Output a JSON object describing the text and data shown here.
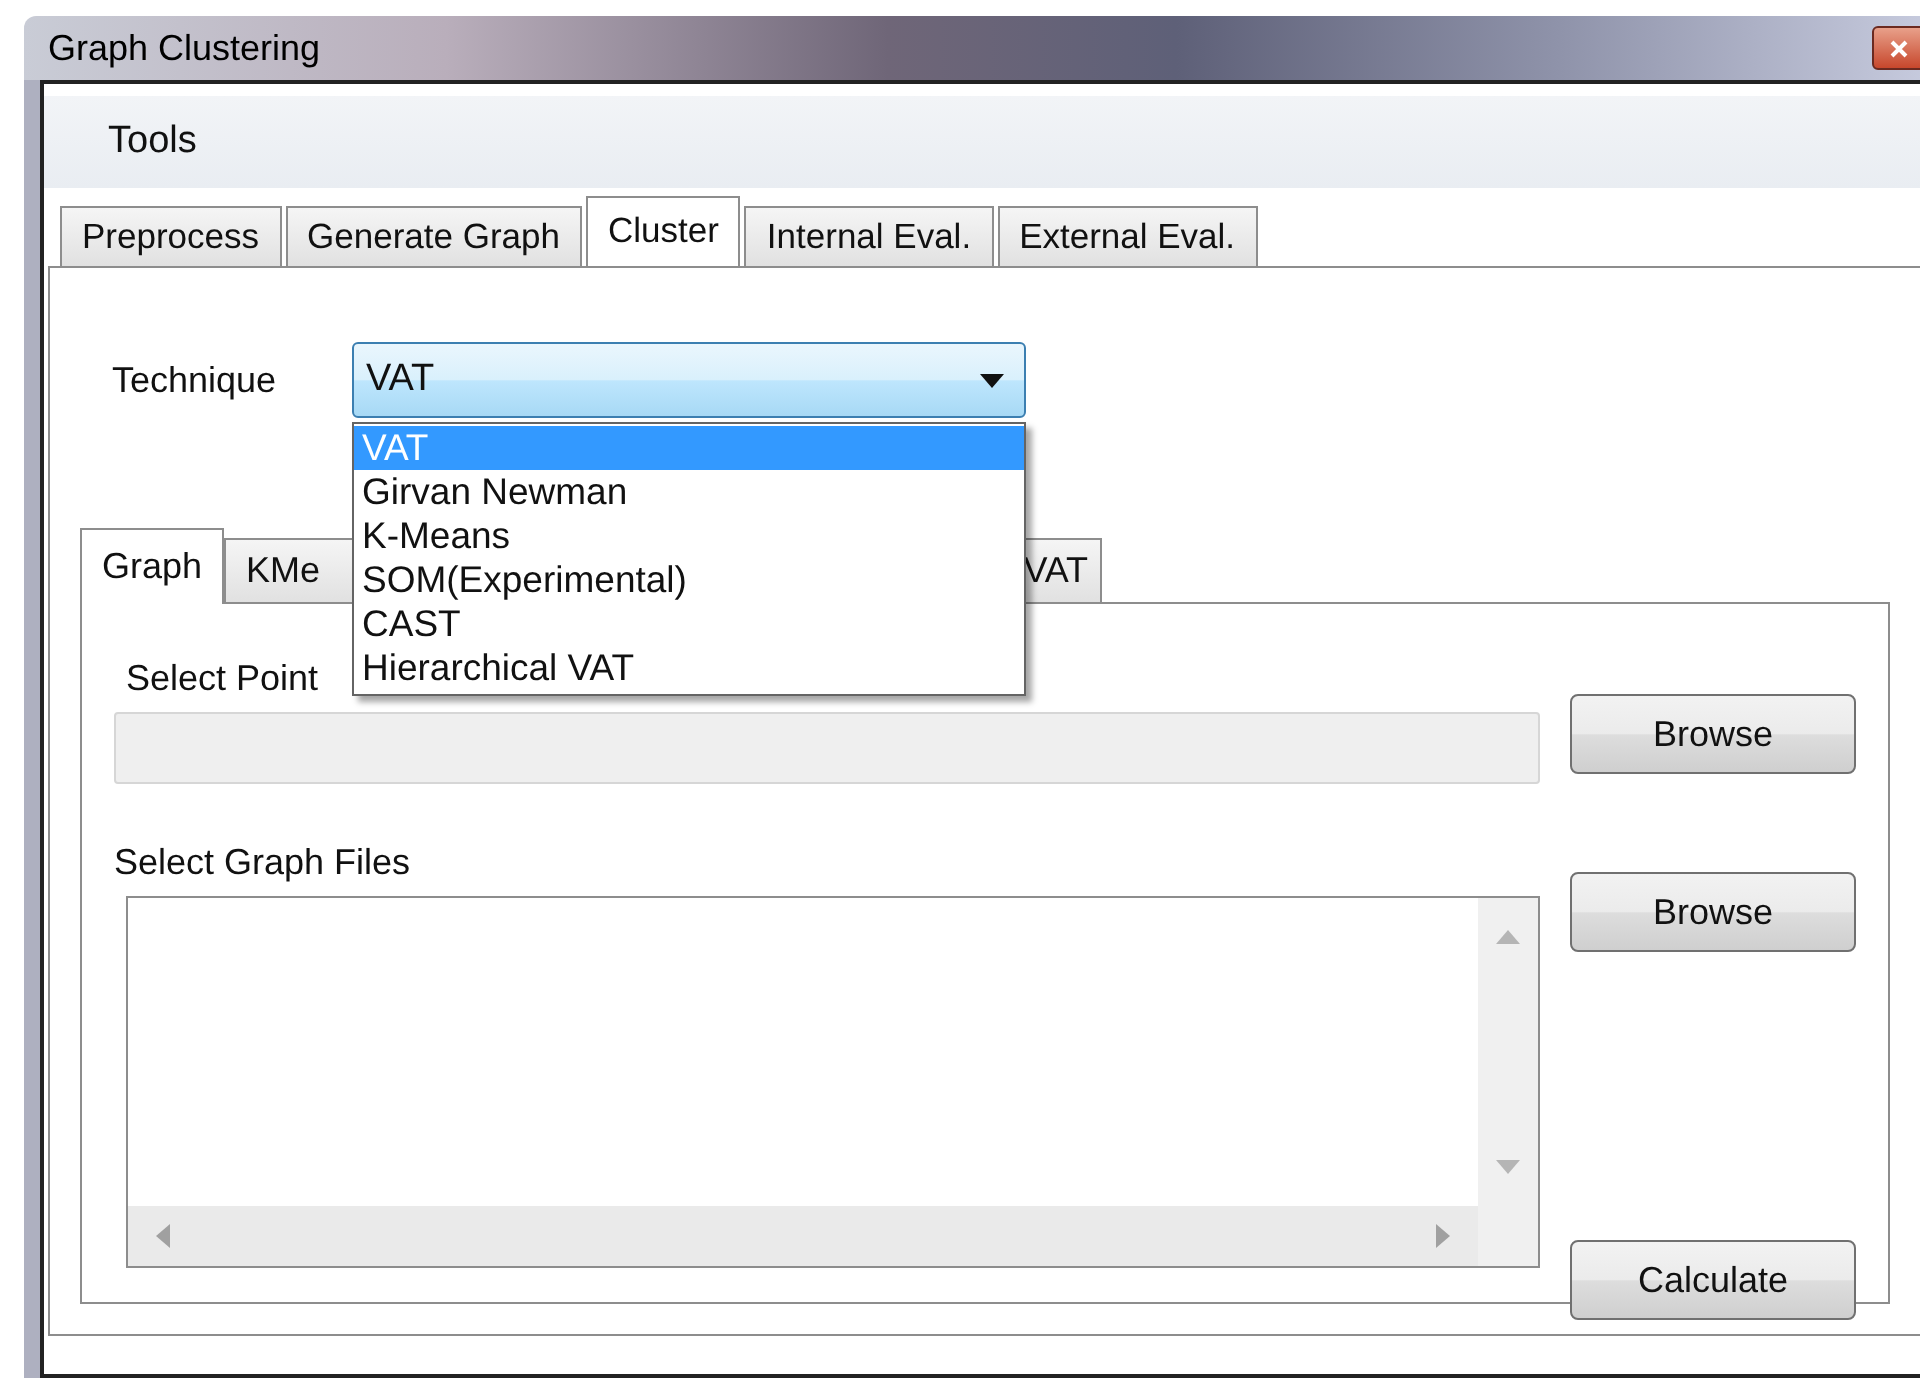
{
  "window": {
    "title": "Graph Clustering"
  },
  "menu": [
    {
      "label": "Tools"
    }
  ],
  "tabs": [
    {
      "label": "Preprocess",
      "selected": false
    },
    {
      "label": "Generate Graph",
      "selected": false
    },
    {
      "label": "Cluster",
      "selected": true
    },
    {
      "label": "Internal Eval.",
      "selected": false
    },
    {
      "label": "External Eval.",
      "selected": false
    }
  ],
  "technique": {
    "label": "Technique",
    "value": "VAT",
    "expanded": true,
    "options": [
      {
        "label": "VAT",
        "selected": true
      },
      {
        "label": "Girvan Newman",
        "selected": false
      },
      {
        "label": "K-Means",
        "selected": false
      },
      {
        "label": "SOM(Experimental)",
        "selected": false
      },
      {
        "label": "CAST",
        "selected": false
      },
      {
        "label": "Hierarchical VAT",
        "selected": false
      }
    ]
  },
  "inner_tabs": [
    {
      "label": "Graph",
      "selected": true
    },
    {
      "label": "KMe",
      "selected": false
    },
    {
      "label": "VAT",
      "selected": false
    }
  ],
  "point_files": {
    "label": "Select Point",
    "disabled": true,
    "button": "Browse"
  },
  "graph_files": {
    "label": "Select Graph Files",
    "button": "Browse"
  },
  "calculate_button": "Calculate"
}
